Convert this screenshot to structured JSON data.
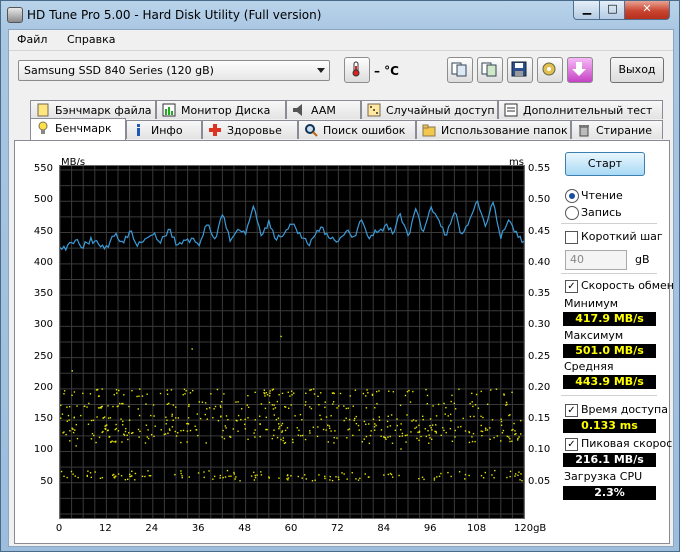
{
  "window": {
    "title": "HD Tune Pro 5.00 - Hard Disk Utility (Full  version)"
  },
  "menu": {
    "file": "Файл",
    "help": "Справка"
  },
  "toolbar": {
    "drive": "Samsung SSD 840 Series (120 gB)",
    "temp": "– °C",
    "exit": "Выход"
  },
  "tabs_top": [
    "Бэнчмарк файла",
    "Монитор Диска",
    "AAM",
    "Случайный доступ",
    "Дополнительный  тест"
  ],
  "tabs_bottom": [
    "Бенчмарк",
    "Инфо",
    "Здоровье",
    "Поиск ошибок",
    "Использование папок",
    "Стирание"
  ],
  "side": {
    "start": "Старт",
    "read": "Чтение",
    "write": "Запись",
    "short_step": "Короткий шаг",
    "step_value": "40",
    "step_unit": "gB",
    "transfer_speed": "Скорость обмен",
    "min_label": "Минимум",
    "min_value": "417.9 MB/s",
    "max_label": "Максимум",
    "max_value": "501.0 MB/s",
    "avg_label": "Средняя",
    "avg_value": "443.9 MB/s",
    "access_label": "Время доступа",
    "access_value": "0.133 ms",
    "burst_label": "Пиковая скорос",
    "burst_value": "216.1 MB/s",
    "cpu_label": "Загрузка CPU",
    "cpu_value": "2.3%"
  },
  "colors": {
    "line": "#3b9bd8",
    "dots": "#e6e600",
    "grid": "#3a3a3a"
  },
  "chart_data": {
    "type": "line",
    "ylabel": "MB/s",
    "y2label": "ms",
    "xlabel": "gB",
    "xlim": [
      0,
      120
    ],
    "ylim": [
      0,
      550
    ],
    "y2lim": [
      0,
      0.55
    ],
    "xticks": [
      "0",
      "12",
      "24",
      "36",
      "48",
      "60",
      "72",
      "84",
      "96",
      "108",
      "120gB"
    ],
    "yticks": [
      "550",
      "500",
      "450",
      "400",
      "350",
      "300",
      "250",
      "200",
      "150",
      "100",
      "50"
    ],
    "y2ticks": [
      "0.55",
      "0.50",
      "0.45",
      "0.40",
      "0.35",
      "0.30",
      "0.25",
      "0.20",
      "0.15",
      "0.10",
      "0.05"
    ],
    "series": [
      {
        "name": "Чтение",
        "x": [
          0,
          2,
          4,
          6,
          8,
          10,
          12,
          14,
          16,
          18,
          20,
          22,
          24,
          26,
          28,
          30,
          32,
          34,
          36,
          38,
          40,
          42,
          44,
          46,
          48,
          50,
          52,
          54,
          56,
          58,
          60,
          62,
          64,
          66,
          68,
          70,
          72,
          74,
          76,
          78,
          80,
          82,
          84,
          86,
          88,
          90,
          92,
          94,
          96,
          98,
          100,
          102,
          104,
          106,
          108,
          110,
          112,
          114,
          116,
          118,
          120
        ],
        "y": [
          426,
          430,
          438,
          425,
          442,
          431,
          429,
          444,
          436,
          452,
          428,
          440,
          446,
          433,
          455,
          430,
          438,
          441,
          429,
          462,
          440,
          478,
          436,
          455,
          447,
          492,
          445,
          470,
          438,
          448,
          463,
          450,
          432,
          446,
          458,
          440,
          436,
          452,
          444,
          470,
          440,
          450,
          461,
          448,
          480,
          445,
          488,
          452,
          491,
          470,
          446,
          482,
          448,
          472,
          500,
          460,
          498,
          440,
          470,
          452,
          436
        ]
      },
      {
        "name": "Время доступа",
        "type": "scatter",
        "bands_ms": [
          0.195,
          0.175,
          0.155,
          0.14,
          0.13,
          0.12,
          0.065,
          0.06
        ],
        "typical_ms": 0.133
      }
    ]
  }
}
